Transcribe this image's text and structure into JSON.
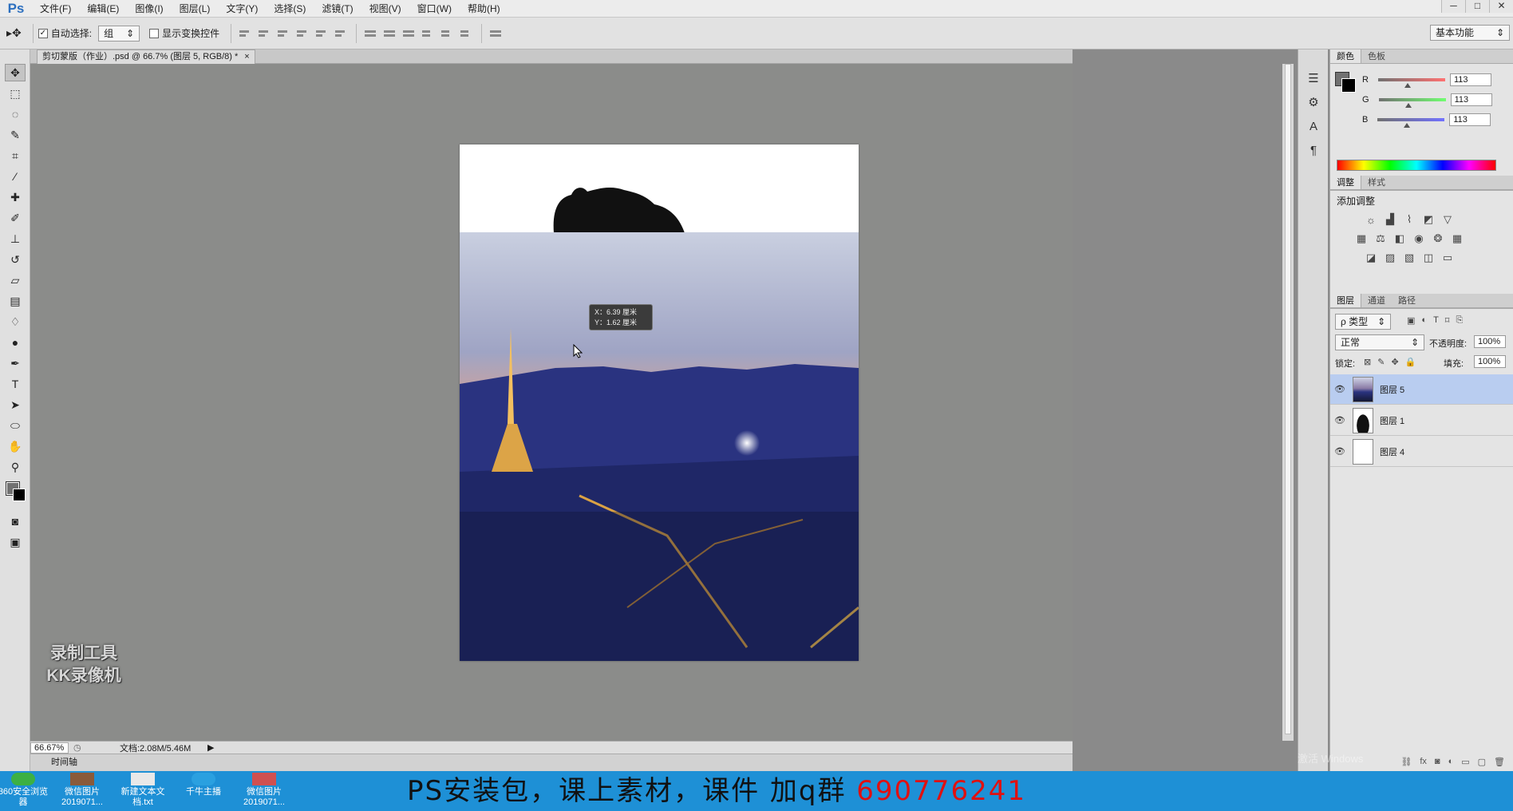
{
  "app": {
    "logo": "Ps"
  },
  "menu": [
    "文件(F)",
    "编辑(E)",
    "图像(I)",
    "图层(L)",
    "文字(Y)",
    "选择(S)",
    "滤镜(T)",
    "视图(V)",
    "窗口(W)",
    "帮助(H)"
  ],
  "window_controls": {
    "minimize": "─",
    "restore": "□",
    "close": "✕"
  },
  "options": {
    "tool_glyph": "▸✥",
    "auto_select_label": "自动选择:",
    "auto_select_checked": "✓",
    "auto_select_value": "组",
    "show_transform_label": "显示变换控件",
    "workspace": "基本功能"
  },
  "document": {
    "tab_title": "剪切蒙版（作业）.psd @ 66.7% (图层 5, RGB/8) *",
    "tab_close": "×",
    "tooltip_line1": "X：6.39 厘米",
    "tooltip_line2": "Y：1.62 厘米"
  },
  "status": {
    "zoom": "66.67%",
    "doc_info": "文档:2.08M/5.46M",
    "timeline": "时间轴"
  },
  "color_panel": {
    "tabs": [
      "颜色",
      "色板"
    ],
    "channels": [
      {
        "label": "R",
        "value": "113",
        "fraction": 0.44
      },
      {
        "label": "G",
        "value": "113",
        "fraction": 0.44
      },
      {
        "label": "B",
        "value": "113",
        "fraction": 0.44
      }
    ]
  },
  "adjust_panel": {
    "tabs": [
      "调整",
      "样式"
    ],
    "heading": "添加调整"
  },
  "layers_panel": {
    "tabs": [
      "图层",
      "通道",
      "路径"
    ],
    "filter_label": "ρ 类型",
    "blend_mode": "正常",
    "opacity_label": "不透明度:",
    "opacity_value": "100%",
    "lock_label": "锁定:",
    "fill_label": "填充:",
    "fill_value": "100%",
    "layers": [
      {
        "name": "图层 5",
        "selected": true
      },
      {
        "name": "图层 1",
        "selected": false
      },
      {
        "name": "图层 4",
        "selected": false
      }
    ]
  },
  "taskbar": {
    "items": [
      "360安全浏览器",
      "微信图片 2019071...",
      "新建文本文档.txt",
      "千牛主播",
      "微信图片 2019071..."
    ],
    "banner_text": "PS安装包，课上素材，课件 加q群 ",
    "banner_number": "690776241"
  },
  "watermark": {
    "line1": "录制工具",
    "line2": "KK录像机"
  },
  "windows_notice": "激活 Windows"
}
